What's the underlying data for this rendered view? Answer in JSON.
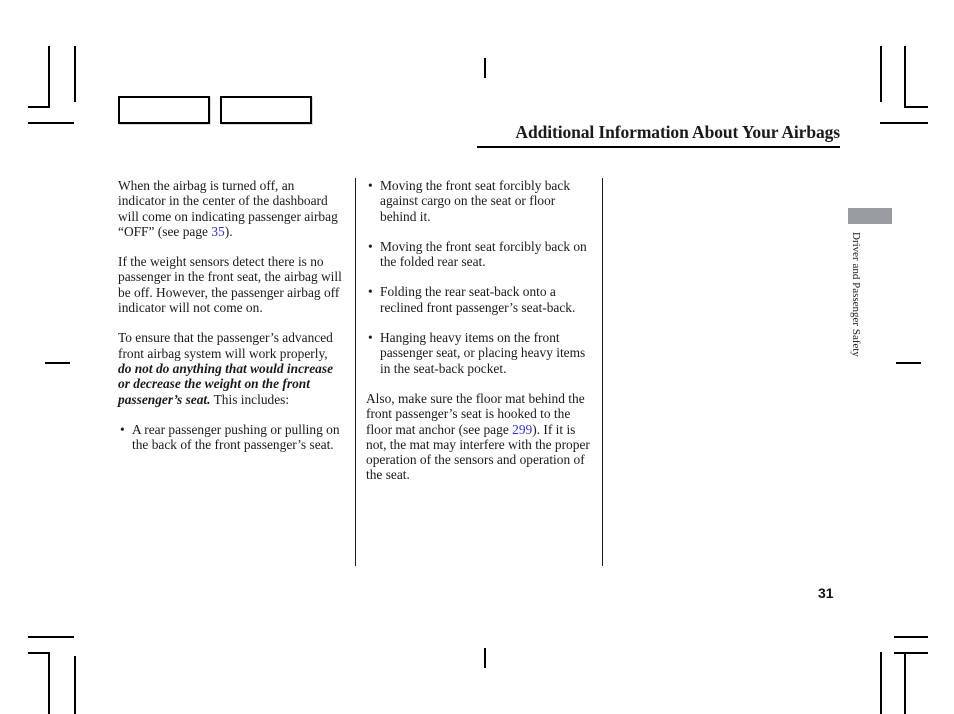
{
  "header": {
    "title": "Additional Information About Your Airbags"
  },
  "left_column": {
    "paragraph_1_part_1": "When the airbag is turned off, an indicator in the center of the dashboard will come on indicating passenger airbag “OFF” (see page",
    "paragraph_1_xref": "35",
    "paragraph_1_part_2": ").",
    "paragraph_2": "If the weight sensors detect there is no passenger in the front seat, the airbag will be off. However, the passenger airbag off indicator will not come on.",
    "paragraph_3_part_1": "To ensure that the passenger’s advanced front airbag system will work properly,",
    "paragraph_3_emphasis": "do not do anything that would increase or decrease the weight on the front passenger’s seat.",
    "paragraph_3_part_2": "This includes:",
    "bullet_marker": "•",
    "bullets": [
      "A rear passenger pushing or pulling on the back of the front passenger’s seat."
    ]
  },
  "right_column": {
    "bullet_marker": "•",
    "bullets": [
      "Moving the front seat forcibly back against cargo on the seat or floor behind it.",
      "Moving the front seat forcibly back on the folded rear seat.",
      "Folding the rear seat-back onto a reclined front passenger’s seat-back.",
      "Hanging heavy items on the front passenger seat, or placing heavy items in the seat-back pocket."
    ],
    "paragraph_1_part_1": "Also, make sure the floor mat behind the front passenger’s seat is hooked to the floor mat anchor (see page",
    "paragraph_1_xref": "299",
    "paragraph_1_part_2": "). If it is not, the mat may interfere with the proper operation of the sensors and operation of the seat."
  },
  "side_tab": {
    "label": "Driver and Passenger Safety"
  },
  "footer": {
    "page_number": "31"
  },
  "colors": {
    "xref_blue": "#3333cc",
    "side_tab_gray": "#999ca0",
    "text_black": "#1a1a1a"
  }
}
